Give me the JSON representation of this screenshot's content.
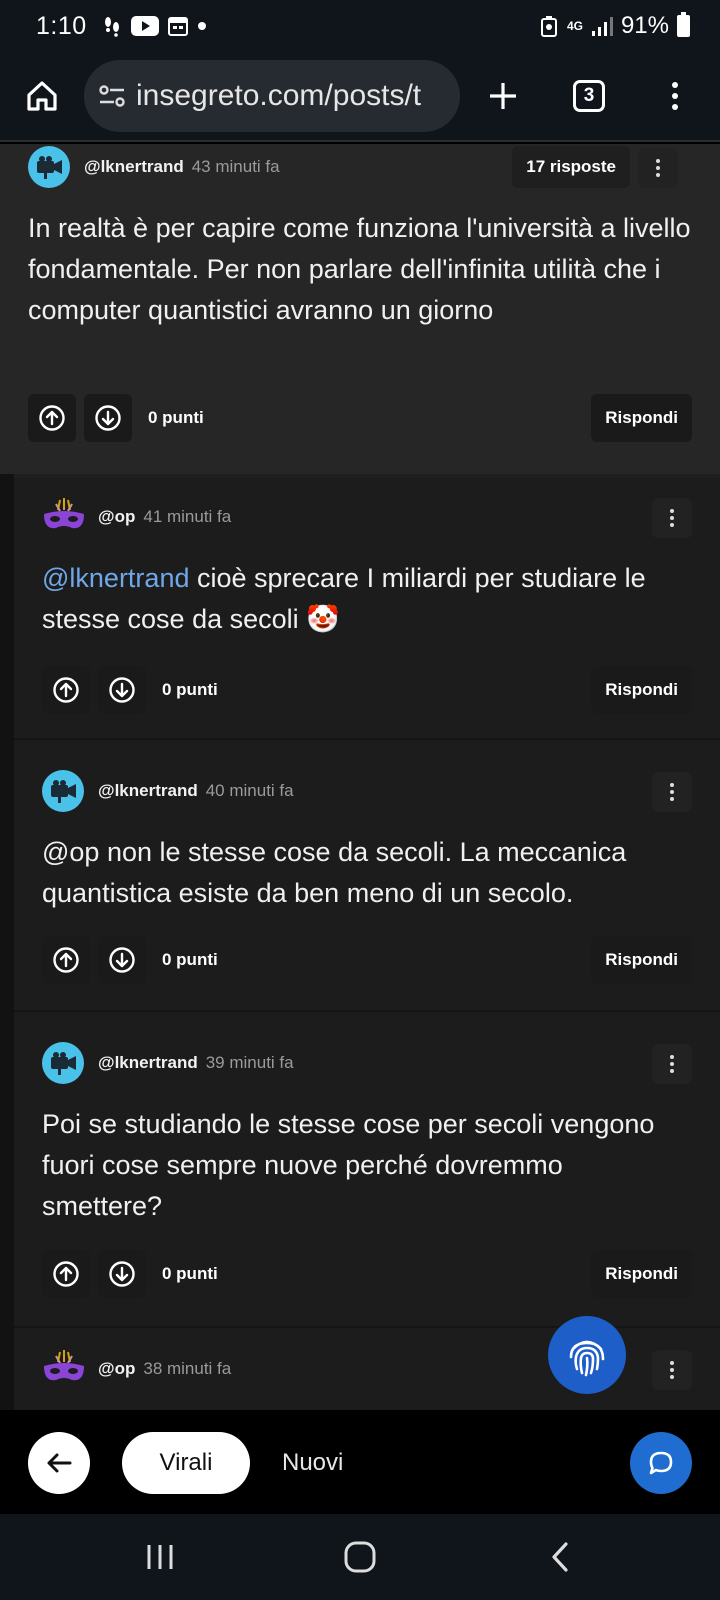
{
  "status_bar": {
    "time": "1:10",
    "network": "4G",
    "battery": "91%"
  },
  "browser": {
    "url": "insegreto.com/posts/t",
    "tab_count": "3"
  },
  "top_comment": {
    "username": "@lknertrand",
    "time": "43 minuti fa",
    "replies": "17 risposte",
    "text": "In realtà è per capire come funziona l'università a livello fondamentale. Per non parlare dell'infinita utilità che i computer quantistici avranno un giorno",
    "points": "0 punti",
    "reply_label": "Rispondi"
  },
  "replies": [
    {
      "username": "@op",
      "time": "41 minuti fa",
      "mention": "@lknertrand",
      "text": " cioè sprecare I miliardi per studiare le stesse cose da secoli 🤡",
      "points": "0 punti",
      "reply_label": "Rispondi"
    },
    {
      "username": "@lknertrand",
      "time": "40 minuti fa",
      "text": "@op non le stesse cose da secoli. La meccanica quantistica esiste da ben meno di un secolo.",
      "points": "0 punti",
      "reply_label": "Rispondi"
    },
    {
      "username": "@lknertrand",
      "time": "39 minuti fa",
      "text": "Poi se studiando le stesse cose per secoli vengono fuori cose sempre nuove perché dovremmo smettere?",
      "points": "0 punti",
      "reply_label": "Rispondi"
    },
    {
      "username": "@op",
      "time": "38 minuti fa"
    }
  ],
  "bottom_nav": {
    "tab_virali": "Virali",
    "tab_nuovi": "Nuovi"
  },
  "colors": {
    "mention": "#6fa8e8",
    "avatar_bg": "#4ac1e8",
    "fab_blue": "#1f6dd0",
    "background": "#1c1c1c"
  }
}
